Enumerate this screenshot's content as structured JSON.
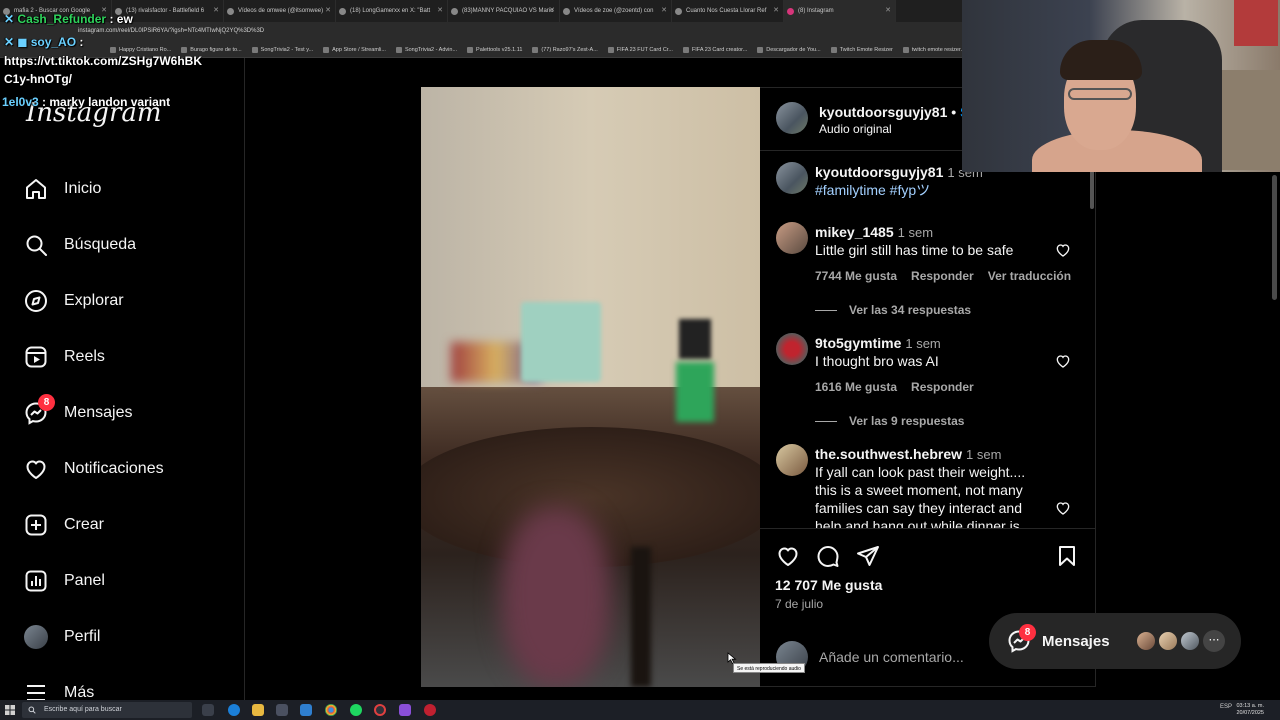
{
  "browser": {
    "tabs": [
      "mafia 2 - Buscar con Google",
      "(13) rivalsfactor - Battlefield 6",
      "Vídeos de omwee (@itsomwee)",
      "(18) LongGamerxx en X: \"Batt",
      "(83)MANNY PACQUIAO VS Mario",
      "Vídeos de zoe (@zoentd) con",
      "Cuanto Nos Cuesta Llorar Ref",
      "(8) Instagram"
    ],
    "url": "instagram.com/reel/DL0IPSiR6YA/?igsh=NTc4MTIwNjQ2YQ%3D%3D",
    "bookmarks": [
      "Happy Cristiano Ro...",
      "Burago figure de to...",
      "SongTrivia2 - Test y...",
      "App Store / Streamli...",
      "SongTrivia2 - Advin...",
      "Palettools v25.1.11",
      "(77) Razo97's Zest-A...",
      "FIFA 23 FUT Card Cr...",
      "FIFA 23 Card creator...",
      "Descargador de You...",
      "Twitch Emote Resizer",
      "twitch emote resizer..."
    ]
  },
  "chat": {
    "line1_user": "Cash_Refunder",
    "line1_msg": ": ew",
    "line2_user": "soy_AO",
    "line2_msg": ":",
    "line3": "https://vt.tiktok.com/ZSHg7W6hBK",
    "line4": "C1y-hnOTg/",
    "line5_user": "1el0v3",
    "line5_msg": ": marky landon variant"
  },
  "sidebar": {
    "logo": "Instagram",
    "items": [
      {
        "label": "Inicio",
        "icon": "home-icon"
      },
      {
        "label": "Búsqueda",
        "icon": "search-icon"
      },
      {
        "label": "Explorar",
        "icon": "compass-icon"
      },
      {
        "label": "Reels",
        "icon": "reels-icon"
      },
      {
        "label": "Mensajes",
        "icon": "messenger-icon",
        "badge": "8"
      },
      {
        "label": "Notificaciones",
        "icon": "heart-icon"
      },
      {
        "label": "Crear",
        "icon": "plus-square-icon"
      },
      {
        "label": "Panel",
        "icon": "bar-chart-icon"
      },
      {
        "label": "Perfil",
        "icon": "avatar"
      },
      {
        "label": "Más",
        "icon": "menu-icon"
      }
    ]
  },
  "post": {
    "author": "kyoutdoorsguyjy81",
    "follow_label": "S",
    "audio": "Audio original",
    "caption_author": "kyoutdoorsguyjy81",
    "caption_time": "1 sem",
    "caption": "#familytime #fypツ",
    "comments": [
      {
        "user": "mikey_1485",
        "time": "1 sem",
        "text": "Little girl still has time to be safe",
        "likes": "7744 Me gusta",
        "reply": "Responder",
        "translate": "Ver traducción",
        "replies": "Ver las 34 respuestas"
      },
      {
        "user": "9to5gymtime",
        "time": "1 sem",
        "text": "I thought bro was AI",
        "likes": "1616 Me gusta",
        "reply": "Responder",
        "replies": "Ver las 9 respuestas"
      },
      {
        "user": "the.southwest.hebrew",
        "time": "1 sem",
        "text": "If yall can look past their weight.... this is a sweet moment, not many families can say they interact and help and hang out while dinner is"
      }
    ],
    "likes_total": "12 707 Me gusta",
    "date": "7 de julio",
    "comment_placeholder": "Añade un comentario..."
  },
  "messages_pill": {
    "label": "Mensajes",
    "badge": "8"
  },
  "cursor_tooltip": "Se está reproduciendo audio",
  "taskbar": {
    "search": "Escribe aquí para buscar",
    "tray": "ESP",
    "time": "03:13 a. m.",
    "date": "20/07/2025"
  },
  "colors": {
    "background": "#000000",
    "accent": "#0095f6",
    "badge": "#ff3040",
    "chat_user": "#2fd35c"
  }
}
